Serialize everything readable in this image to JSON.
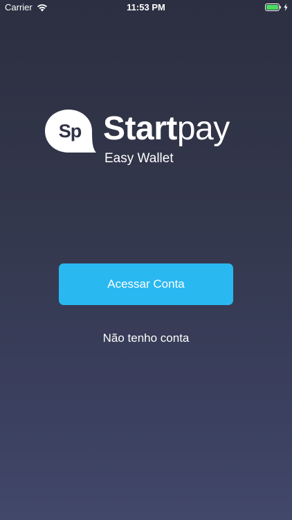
{
  "status_bar": {
    "carrier": "Carrier",
    "time": "11:53 PM",
    "battery_color": "#4cd964"
  },
  "logo": {
    "mark_text": "Sp",
    "brand_bold": "Start",
    "brand_light": "pay",
    "tagline": "Easy Wallet"
  },
  "actions": {
    "primary_label": "Acessar Conta",
    "secondary_label": "Não tenho conta",
    "primary_color": "#2ab8f1"
  }
}
